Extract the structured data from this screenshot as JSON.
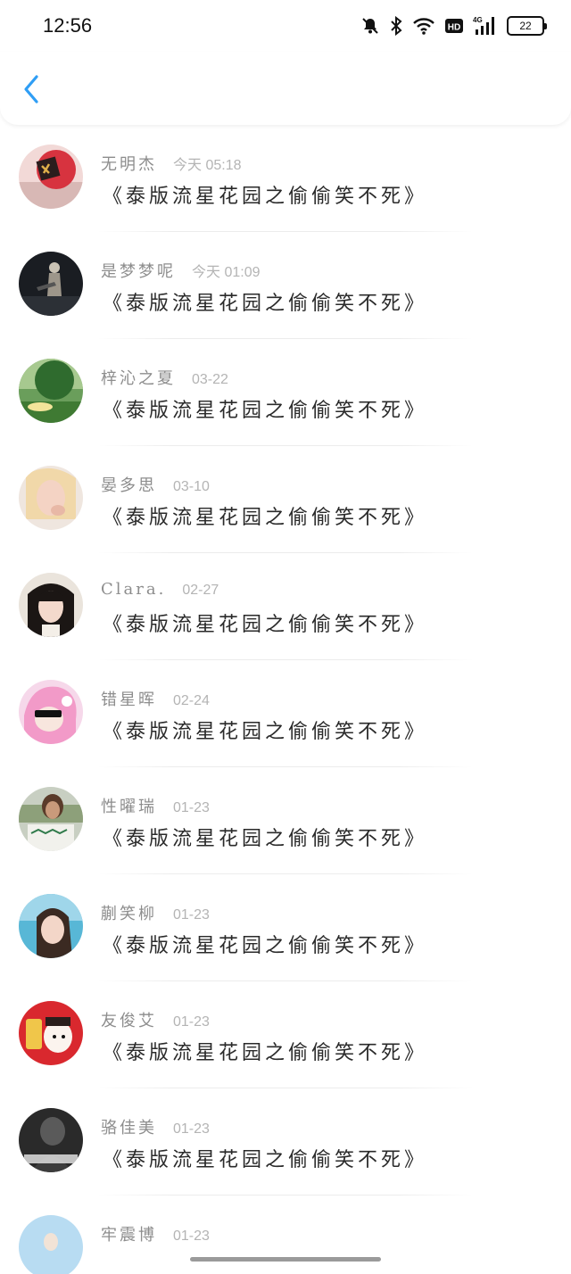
{
  "status_bar": {
    "time": "12:56",
    "network": "4G",
    "battery": "22"
  },
  "header": {
    "back_icon": "chevron-left-icon",
    "accent_color": "#2f9ef5"
  },
  "comments": [
    {
      "name": "无明杰",
      "time": "今天 05:18",
      "text": "《泰版流星花园之偷偷笑不死》"
    },
    {
      "name": "是梦梦呢",
      "time": "今天 01:09",
      "text": "《泰版流星花园之偷偷笑不死》"
    },
    {
      "name": "梓沁之夏",
      "time": "03-22",
      "text": "《泰版流星花园之偷偷笑不死》"
    },
    {
      "name": "晏多思",
      "time": "03-10",
      "text": "《泰版流星花园之偷偷笑不死》"
    },
    {
      "name": "Clara.",
      "time": "02-27",
      "text": "《泰版流星花园之偷偷笑不死》"
    },
    {
      "name": "错星晖",
      "time": "02-24",
      "text": "《泰版流星花园之偷偷笑不死》"
    },
    {
      "name": "性曜瑞",
      "time": "01-23",
      "text": "《泰版流星花园之偷偷笑不死》"
    },
    {
      "name": "蒯笑柳",
      "time": "01-23",
      "text": "《泰版流星花园之偷偷笑不死》"
    },
    {
      "name": "友俊艾",
      "time": "01-23",
      "text": "《泰版流星花园之偷偷笑不死》"
    },
    {
      "name": "骆佳美",
      "time": "01-23",
      "text": "《泰版流星花园之偷偷笑不死》"
    },
    {
      "name": "牢震博",
      "time": "01-23",
      "text": ""
    }
  ]
}
